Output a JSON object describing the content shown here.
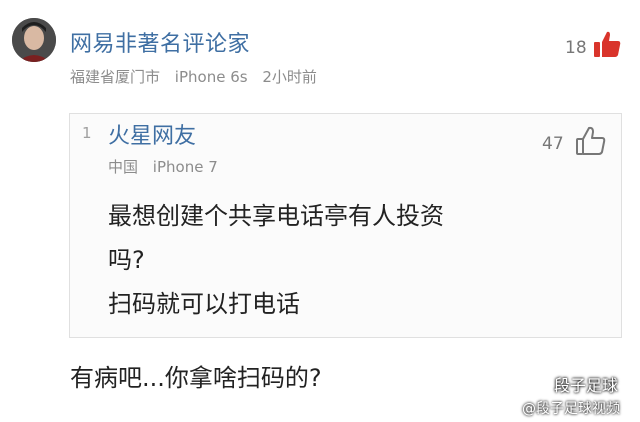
{
  "comment": {
    "username": "网易非著名评论家",
    "location": "福建省厦门市",
    "device": "iPhone 6s",
    "time": "2小时前",
    "like_count": "18",
    "like_icon": "thumbs-up-filled-icon",
    "reply_text": "有病吧...你拿啥扫码的?"
  },
  "quoted": {
    "floor": "1",
    "username": "火星网友",
    "location": "中国",
    "device": "iPhone 7",
    "like_count": "47",
    "like_icon": "thumbs-up-outline-icon",
    "lines": [
      "最想创建个共享电话亭有人投资",
      "吗?",
      "扫码就可以打电话"
    ]
  },
  "watermark": {
    "title": "段子足球",
    "handle": "@段子足球视频"
  },
  "colors": {
    "username": "#3f6fa3",
    "meta": "#8c8c8c",
    "like_red": "#d9342b",
    "body_text": "#222222"
  }
}
